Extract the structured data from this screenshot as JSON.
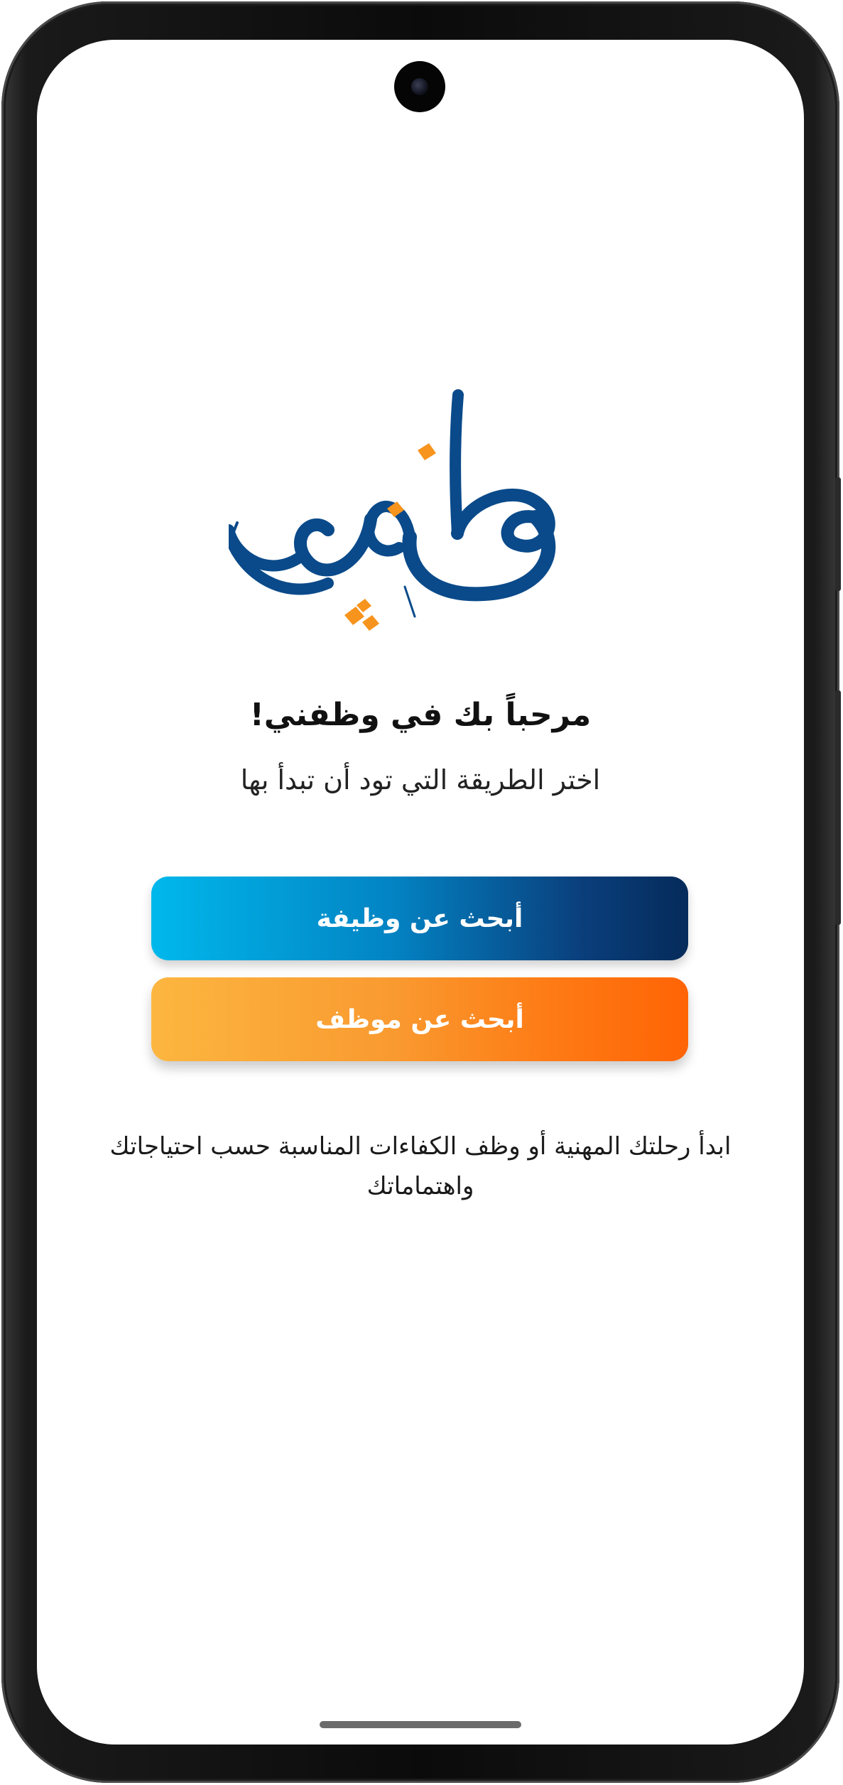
{
  "app": {
    "logo_text": "وظفني"
  },
  "welcome": {
    "title": "مرحباً بك في وظفني!",
    "subtitle": "اختر الطريقة التي تود أن تبدأ بها"
  },
  "actions": {
    "find_job_label": "أبحث عن وظيفة",
    "find_employee_label": "أبحث عن موظف"
  },
  "description": "ابدأ رحلتك المهنية أو وظف الكفاءات المناسبة حسب احتياجاتك واهتماماتك",
  "colors": {
    "brand_blue": "#0a4a8a",
    "brand_orange": "#f7941d",
    "job_button_gradient": [
      "#00b8ec",
      "#052b5a"
    ],
    "employee_button_gradient": [
      "#fcb640",
      "#ff6405"
    ]
  }
}
